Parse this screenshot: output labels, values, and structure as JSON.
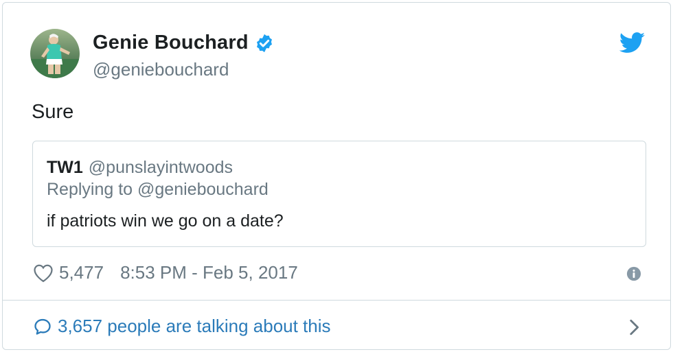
{
  "tweet": {
    "author": {
      "name": "Genie Bouchard",
      "handle": "@geniebouchard",
      "verified": true,
      "avatar_icon": "tennis-player-avatar"
    },
    "text": "Sure",
    "quoted": {
      "name": "TW1",
      "handle": "@punslayintwoods",
      "reply_to": "Replying to @geniebouchard",
      "text": "if patriots win we go on a date?"
    },
    "likes": "5,477",
    "timestamp": "8:53 PM - Feb 5, 2017",
    "conversation_label": "3,657 people are talking about this"
  },
  "colors": {
    "twitter_blue": "#1da1f2",
    "link_blue": "#2b7bb9",
    "muted_gray": "#697882",
    "border": "#cfd9de",
    "text": "#1c2022"
  },
  "icons": {
    "brand": "twitter-bird-icon",
    "verified": "verified-badge-icon",
    "like": "heart-icon",
    "info": "info-icon",
    "reply": "speech-bubble-icon",
    "more": "chevron-right-icon"
  }
}
